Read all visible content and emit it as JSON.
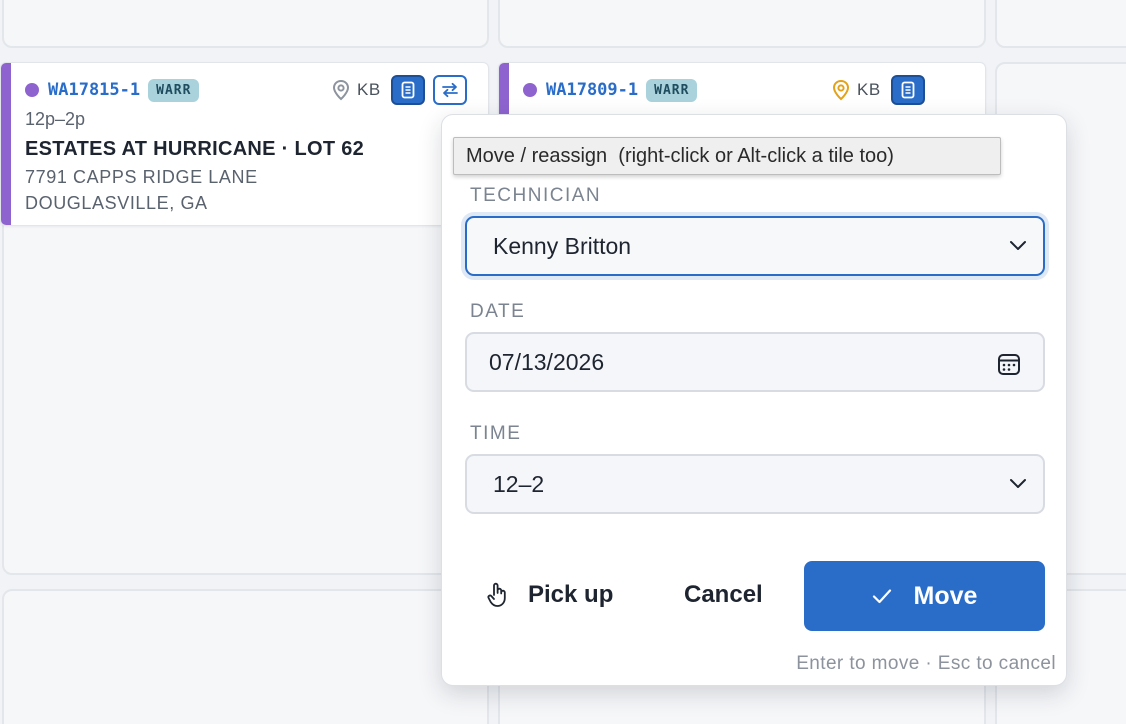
{
  "tiles": [
    {
      "id": "WA17815-1",
      "badge": "WARR",
      "initials": "KB",
      "time": "12p–2p",
      "name": "ESTATES AT HURRICANE · LOT 62",
      "address_line1": "7791 CAPPS RIDGE LANE",
      "address_line2": "DOUGLASVILLE, GA",
      "pin_color": "#8d949e"
    },
    {
      "id": "WA17809-1",
      "badge": "WARR",
      "initials": "KB",
      "pin_color": "#e3a21a"
    }
  ],
  "tooltip": "Move / reassign  (right-click or Alt-click a tile too)",
  "popover": {
    "technician_label": "TECHNICIAN",
    "technician_value": "Kenny Britton",
    "date_label": "DATE",
    "date_value": "07/13/2026",
    "time_label": "TIME",
    "time_value": "12–2",
    "pickup_label": "Pick up",
    "cancel_label": "Cancel",
    "move_label": "Move",
    "hint": "Enter to move · Esc to cancel"
  },
  "colors": {
    "accent": "#2a6dc9",
    "tile_accent": "#8e63cf",
    "badge_bg": "#a9d2dc"
  }
}
